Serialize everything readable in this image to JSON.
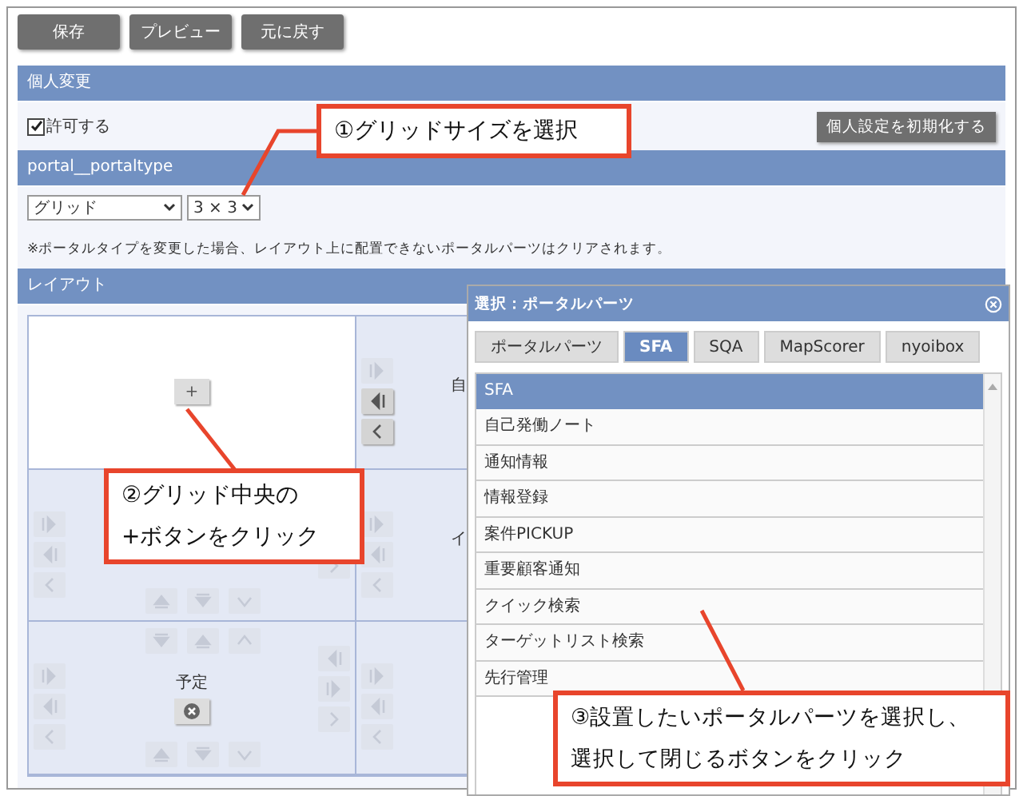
{
  "toolbar": {
    "buttons": [
      "保存",
      "プレビュー",
      "元に戻す"
    ]
  },
  "personal": {
    "title": "個人変更",
    "allow": {
      "label": "許可する",
      "checked": true
    },
    "reset_button": "個人設定を初期化する"
  },
  "portal_type": {
    "title": "portal__portaltype",
    "type_select": "グリッド",
    "size_select": "3 × 3",
    "note": "※ポータルタイプを変更した場合、レイアウト上に配置できないポータルパーツはクリアされます。"
  },
  "layout": {
    "title": "レイアウト",
    "rows": [
      [
        {
          "kind": "add",
          "add_button": "+"
        },
        {
          "kind": "part",
          "label": "自",
          "active": true
        }
      ],
      [
        {
          "kind": "empty",
          "active": false
        },
        {
          "kind": "part",
          "label": "イ",
          "active": false
        }
      ],
      [
        {
          "kind": "part",
          "label": "予定",
          "removable": true,
          "active": false
        },
        {
          "kind": "empty",
          "active": false
        }
      ]
    ]
  },
  "dialog": {
    "title": "選択：ポータルパーツ",
    "tabs": [
      {
        "label": "ポータルパーツ",
        "selected": false
      },
      {
        "label": "SFA",
        "selected": true
      },
      {
        "label": "SQA",
        "selected": false
      },
      {
        "label": "MapScorer",
        "selected": false
      },
      {
        "label": "nyoibox",
        "selected": false
      }
    ],
    "group": "SFA",
    "items": [
      "自己発働ノート",
      "通知情報",
      "情報登録",
      "案件PICKUP",
      "重要顧客通知",
      "クイック検索",
      "ターゲットリスト検索",
      "先行管理"
    ]
  },
  "callouts": [
    {
      "lines": [
        "①グリッドサイズを選択"
      ]
    },
    {
      "lines": [
        "②グリッド中央の",
        "+ボタンをクリック"
      ]
    },
    {
      "lines": [
        "③設置したいポータルパーツを選択し、",
        "選択して閉じるボタンをクリック"
      ]
    }
  ]
}
